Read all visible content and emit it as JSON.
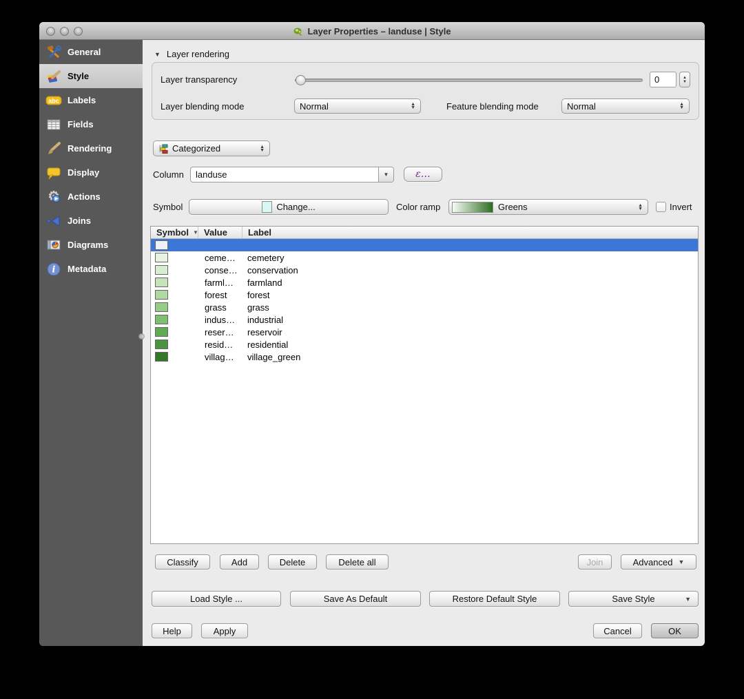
{
  "window": {
    "title": "Layer Properties – landuse | Style"
  },
  "sidebar": {
    "items": [
      {
        "label": "General",
        "icon": "hammer-wrench-icon",
        "selected": false
      },
      {
        "label": "Style",
        "icon": "paint-layers-icon",
        "selected": true
      },
      {
        "label": "Labels",
        "icon": "abc-badge-icon",
        "selected": false
      },
      {
        "label": "Fields",
        "icon": "attribute-table-icon",
        "selected": false
      },
      {
        "label": "Rendering",
        "icon": "paintbrush-icon",
        "selected": false
      },
      {
        "label": "Display",
        "icon": "speech-bubble-icon",
        "selected": false
      },
      {
        "label": "Actions",
        "icon": "gear-play-icon",
        "selected": false
      },
      {
        "label": "Joins",
        "icon": "join-arrow-icon",
        "selected": false
      },
      {
        "label": "Diagrams",
        "icon": "pie-diagram-icon",
        "selected": false
      },
      {
        "label": "Metadata",
        "icon": "info-icon",
        "selected": false
      }
    ]
  },
  "layer_rendering": {
    "section_title": "Layer rendering",
    "transparency_label": "Layer transparency",
    "transparency_value": "0",
    "transparency_percent": 0,
    "layer_blending_label": "Layer blending mode",
    "layer_blending_value": "Normal",
    "feature_blending_label": "Feature blending mode",
    "feature_blending_value": "Normal"
  },
  "renderer": {
    "type_value": "Categorized",
    "column_label": "Column",
    "column_value": "landuse",
    "expression_button_label": "ε…",
    "symbol_label": "Symbol",
    "symbol_button_label": "Change...",
    "symbol_fill_color": "#d8f6f4",
    "color_ramp_label": "Color ramp",
    "color_ramp_value": "Greens",
    "color_ramp_start": "#f7fcf5",
    "color_ramp_end": "#2e6e21",
    "invert_label": "Invert"
  },
  "categories_table": {
    "columns": {
      "symbol": "Symbol",
      "value": "Value",
      "label": "Label"
    },
    "sort_column": "Symbol",
    "selection_color": "#3b76d8",
    "rows": [
      {
        "color": "#eef1f8",
        "value": "",
        "label": "",
        "selected": true
      },
      {
        "color": "#e7f4e3",
        "value": "ceme…",
        "label": "cemetery",
        "selected": false
      },
      {
        "color": "#d8eed0",
        "value": "conse…",
        "label": "conservation",
        "selected": false
      },
      {
        "color": "#c6e4ba",
        "value": "farml…",
        "label": "farmland",
        "selected": false
      },
      {
        "color": "#afd9a0",
        "value": "forest",
        "label": "forest",
        "selected": false
      },
      {
        "color": "#96cc86",
        "value": "grass",
        "label": "grass",
        "selected": false
      },
      {
        "color": "#7fc06e",
        "value": "indus…",
        "label": "industrial",
        "selected": false
      },
      {
        "color": "#63ab52",
        "value": "reser…",
        "label": "reservoir",
        "selected": false
      },
      {
        "color": "#4a9340",
        "value": "resid…",
        "label": "residential",
        "selected": false
      },
      {
        "color": "#33772b",
        "value": "villag…",
        "label": "village_green",
        "selected": false
      }
    ]
  },
  "category_actions": {
    "classify": "Classify",
    "add": "Add",
    "delete": "Delete",
    "delete_all": "Delete all",
    "join": "Join",
    "join_enabled": false,
    "advanced": "Advanced"
  },
  "style_actions": {
    "load_style": "Load Style ...",
    "save_as_default": "Save As Default",
    "restore_default": "Restore Default Style",
    "save_style": "Save Style"
  },
  "dialog_actions": {
    "help": "Help",
    "apply": "Apply",
    "cancel": "Cancel",
    "ok": "OK"
  }
}
